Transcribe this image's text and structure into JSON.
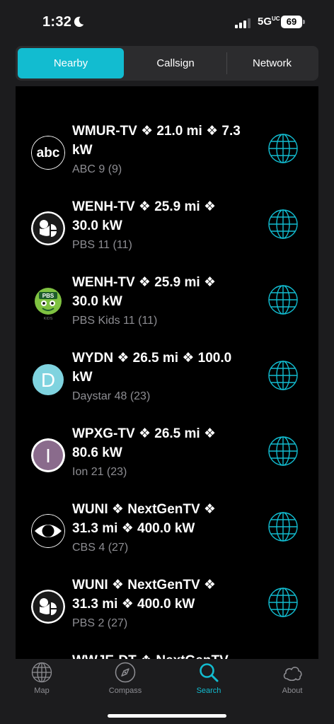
{
  "status_bar": {
    "time": "1:32",
    "network": "5G",
    "network_suffix": "UC",
    "battery": "69"
  },
  "segments": [
    {
      "label": "Nearby",
      "active": true
    },
    {
      "label": "Callsign",
      "active": false
    },
    {
      "label": "Network",
      "active": false
    }
  ],
  "stations": [
    {
      "title": "WMUR-TV  ❖ 21.0 mi ❖ 7.3 kW",
      "subtitle": "ABC 9 (9)",
      "logo": "abc-logo"
    },
    {
      "title": "WENH-TV  ❖ 25.9 mi ❖ 30.0 kW",
      "subtitle": "PBS 11 (11)",
      "logo": "pbs-logo"
    },
    {
      "title": "WENH-TV  ❖ 25.9 mi ❖ 30.0 kW",
      "subtitle": "PBS Kids 11 (11)",
      "logo": "pbs-kids-logo",
      "logo_text": "PBS",
      "logo_caption": "KIDS"
    },
    {
      "title": "WYDN  ❖ 26.5 mi ❖ 100.0 kW",
      "subtitle": "Daystar 48 (23)",
      "logo": "daystar-logo",
      "logo_text": "D"
    },
    {
      "title": "WPXG-TV  ❖ 26.5 mi ❖ 80.6 kW",
      "subtitle": "Ion 21 (23)",
      "logo": "ion-logo",
      "logo_text": "I"
    },
    {
      "title": "WUNI ❖ NextGenTV  ❖ 31.3 mi ❖ 400.0 kW",
      "subtitle": "CBS 4 (27)",
      "logo": "cbs-logo"
    },
    {
      "title": "WUNI ❖ NextGenTV  ❖ 31.3 mi ❖ 400.0 kW",
      "subtitle": "PBS 2 (27)",
      "logo": "pbs-logo"
    },
    {
      "title": "WWJE-DT ❖ NextGenTV  ❖",
      "subtitle": "",
      "logo": ""
    }
  ],
  "tabs": [
    {
      "label": "Map",
      "icon": "globe-icon",
      "active": false
    },
    {
      "label": "Compass",
      "icon": "compass-icon",
      "active": false
    },
    {
      "label": "Search",
      "icon": "search-icon",
      "active": true
    },
    {
      "label": "About",
      "icon": "cloud-icon",
      "active": false
    }
  ],
  "colors": {
    "accent": "#12bcd0",
    "background": "#1c1c1e",
    "list_background": "#000000",
    "secondary_text": "#8e8e93",
    "daystar": "#7fd3df",
    "ion": "#8a6b8c"
  }
}
